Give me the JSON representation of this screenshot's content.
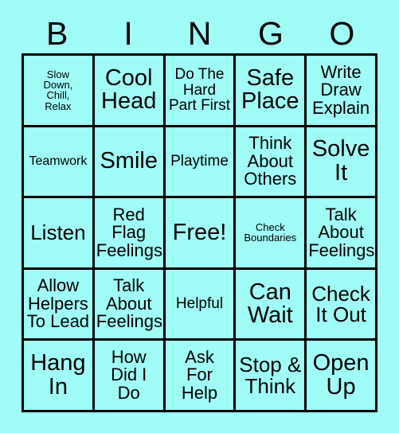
{
  "card": {
    "title": "BINGO",
    "background_color": "#a0fcf7",
    "border_color": "#000000",
    "text_color": "#000000"
  },
  "header": {
    "letters": [
      {
        "label": "B"
      },
      {
        "label": "I"
      },
      {
        "label": "N"
      },
      {
        "label": "G"
      },
      {
        "label": "O"
      }
    ]
  },
  "grid": {
    "rows": 5,
    "columns": 5,
    "free_space_index": 12,
    "cells": [
      {
        "label": "Slow\nDown,\nChill,\nRelax",
        "size": "xs"
      },
      {
        "label": "Cool\nHead",
        "size": "xxl"
      },
      {
        "label": "Do The\nHard\nPart First",
        "size": "m"
      },
      {
        "label": "Safe\nPlace",
        "size": "xxl"
      },
      {
        "label": "Write\nDraw\nExplain",
        "size": "l"
      },
      {
        "label": "Teamwork",
        "size": "s"
      },
      {
        "label": "Smile",
        "size": "xxl"
      },
      {
        "label": "Playtime",
        "size": "m"
      },
      {
        "label": "Think\nAbout\nOthers",
        "size": "l"
      },
      {
        "label": "Solve\nIt",
        "size": "xxl"
      },
      {
        "label": "Listen",
        "size": "xl"
      },
      {
        "label": "Red\nFlag\nFeelings",
        "size": "l"
      },
      {
        "label": "Free!",
        "size": "xxl"
      },
      {
        "label": "Check\nBoundaries",
        "size": "xs"
      },
      {
        "label": "Talk\nAbout\nFeelings",
        "size": "l"
      },
      {
        "label": "Allow\nHelpers\nTo Lead",
        "size": "l"
      },
      {
        "label": "Talk\nAbout\nFeelings",
        "size": "l"
      },
      {
        "label": "Helpful",
        "size": "m"
      },
      {
        "label": "Can\nWait",
        "size": "xxl"
      },
      {
        "label": "Check\nIt Out",
        "size": "xl"
      },
      {
        "label": "Hang\nIn",
        "size": "xxl"
      },
      {
        "label": "How\nDid I\nDo",
        "size": "l"
      },
      {
        "label": "Ask\nFor\nHelp",
        "size": "l"
      },
      {
        "label": "Stop &\nThink",
        "size": "xl"
      },
      {
        "label": "Open\nUp",
        "size": "xxl"
      }
    ]
  }
}
